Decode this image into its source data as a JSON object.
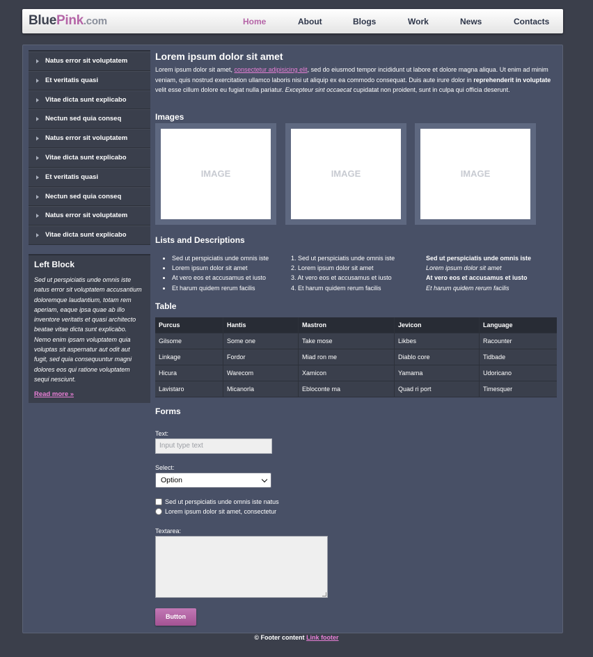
{
  "header": {
    "logo_blue": "Blue",
    "logo_pink": "Pink",
    "logo_com": ".com",
    "nav": [
      "Home",
      "About",
      "Blogs",
      "Work",
      "News",
      "Contacts"
    ],
    "active": "Home"
  },
  "sidebar": {
    "items": [
      "Natus error sit voluptatem",
      "Et veritatis quasi",
      "Vitae dicta sunt explicabo",
      "Nectun sed quia conseq",
      "Natus error sit voluptatem",
      "Vitae dicta sunt explicabo",
      "Et veritatis quasi",
      "Nectun sed quia conseq",
      "Natus error sit voluptatem",
      "Vitae dicta sunt explicabo"
    ],
    "block": {
      "title": "Left Block",
      "text": "Sed ut perspiciatis unde omnis iste natus error sit voluptatem accusantium doloremque laudantium, totam rem aperiam, eaque ipsa quae ab illo inventore veritatis et quasi architecto beatae vitae dicta sunt explicabo. Nemo enim ipsam voluptatem quia voluptas sit aspernatur aut odit aut fugit, sed quia consequuntur magni dolores eos qui ratione voluptatem sequi nesciunt.",
      "link": "Read more »"
    }
  },
  "main": {
    "title": "Lorem ipsum dolor sit amet",
    "intro": {
      "part1": "Lorem ipsum dolor sit amet, ",
      "link": "consectetur adipisicing elit",
      "part2": ", sed do eiusmod tempor incididunt ut labore et dolore magna aliqua. Ut enim ad minim veniam, quis nostrud exercitation ullamco laboris nisi ut aliquip ex ea commodo consequat. Duis aute irure dolor in ",
      "bold": "reprehenderit in voluptate",
      "part3": " velit esse cillum dolore eu fugiat nulla pariatur. ",
      "italic": "Excepteur sint occaecat",
      "part4": " cupidatat non proident, sunt in culpa qui officia deserunt."
    },
    "images_heading": "Images",
    "image_label": "IMAGE",
    "lists_heading": "Lists and Descriptions",
    "ul": [
      "Sed ut perspiciatis unde omnis iste",
      "Lorem ipsum dolor sit amet",
      "At vero eos et accusamus et iusto",
      "Et harum quidem rerum facilis"
    ],
    "ol": [
      "1. Sed ut perspiciatis unde omnis iste",
      "2. Lorem ipsum dolor sit amet",
      "3. At vero eos et accusamus et iusto",
      "4. Et harum quidem rerum facilis"
    ],
    "dl": [
      {
        "term": "Sed ut perspiciatis unde omnis iste",
        "desc": "Lorem ipsum dolor sit amet"
      },
      {
        "term": "At vero eos et accusamus et iusto",
        "desc": "Et harum quidem rerum facilis"
      }
    ],
    "table_heading": "Table",
    "table": {
      "headers": [
        "Purcus",
        "Hantis",
        "Mastron",
        "Jevicon",
        "Language"
      ],
      "rows": [
        [
          "Gilsome",
          "Some one",
          "Take mose",
          "Likbes",
          "Racounter"
        ],
        [
          "Linkage",
          "Fordor",
          "Miad ron me",
          "Diablo core",
          "Tidbade"
        ],
        [
          "Hicura",
          "Warecom",
          "Xamicon",
          "Yamama",
          "Udoricano"
        ],
        [
          "Lavistaro",
          "Micanorla",
          "Ebloconte ma",
          "Quad ri port",
          "Timesquer"
        ]
      ]
    },
    "forms_heading": "Forms",
    "forms": {
      "text_label": "Text:",
      "text_placeholder": "Input type text",
      "select_label": "Select:",
      "select_value": "Option",
      "checkbox_label": "Sed ut perspiciatis unde omnis iste natus",
      "radio_label": "Lorem ipsum dolor sit amet, consectetur",
      "textarea_label": "Textarea:",
      "button_label": "Button"
    }
  },
  "footer": {
    "text": "© Footer content ",
    "link": "Link footer"
  }
}
